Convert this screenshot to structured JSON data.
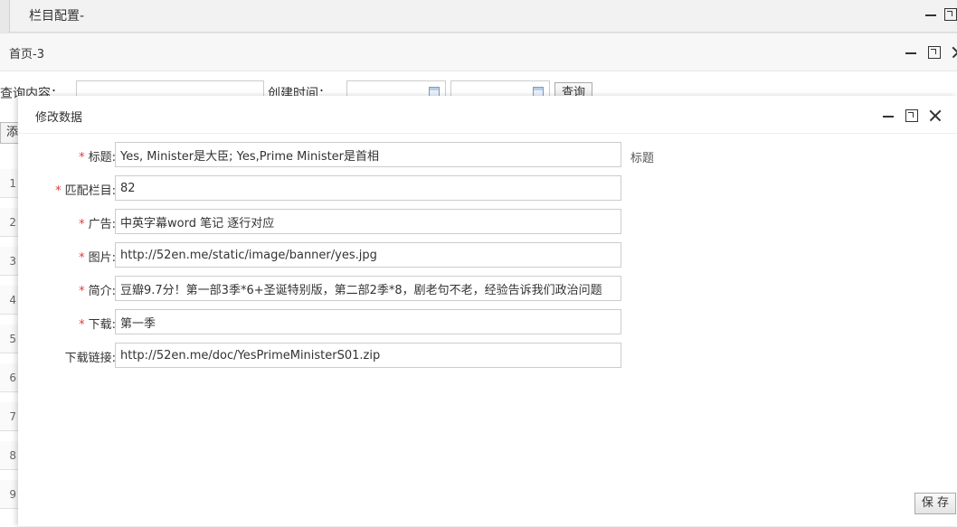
{
  "outer_window": {
    "title": "栏目配置-"
  },
  "mid_window": {
    "title": "首页-3"
  },
  "search": {
    "content_label": "查询内容：",
    "created_label": "创建时间：",
    "query_button": "查询",
    "add_button": "添"
  },
  "row_numbers": [
    "1",
    "2",
    "3",
    "4",
    "5",
    "6",
    "7",
    "8",
    "9"
  ],
  "modal": {
    "title": "修改数据",
    "fields": [
      {
        "label": "标题:",
        "required": "*",
        "value": "Yes, Minister是大臣; Yes,Prime Minister是首相",
        "hint": "标题"
      },
      {
        "label": "匹配栏目:",
        "required": "*",
        "value": "82"
      },
      {
        "label": "广告:",
        "required": "*",
        "value": "中英字幕word 笔记 逐行对应"
      },
      {
        "label": "图片:",
        "required": "*",
        "value": "http://52en.me/static/image/banner/yes.jpg"
      },
      {
        "label": "简介:",
        "required": "*",
        "value": "豆瓣9.7分！第一部3季*6+圣诞特别版，第二部2季*8，剧老句不老，经验告诉我们政治问题"
      },
      {
        "label": "下载:",
        "required": "*",
        "value": "第一季"
      },
      {
        "label": "下载链接:",
        "required": "",
        "value": "http://52en.me/doc/YesPrimeMinisterS01.zip"
      }
    ],
    "save_button": "保 存"
  }
}
